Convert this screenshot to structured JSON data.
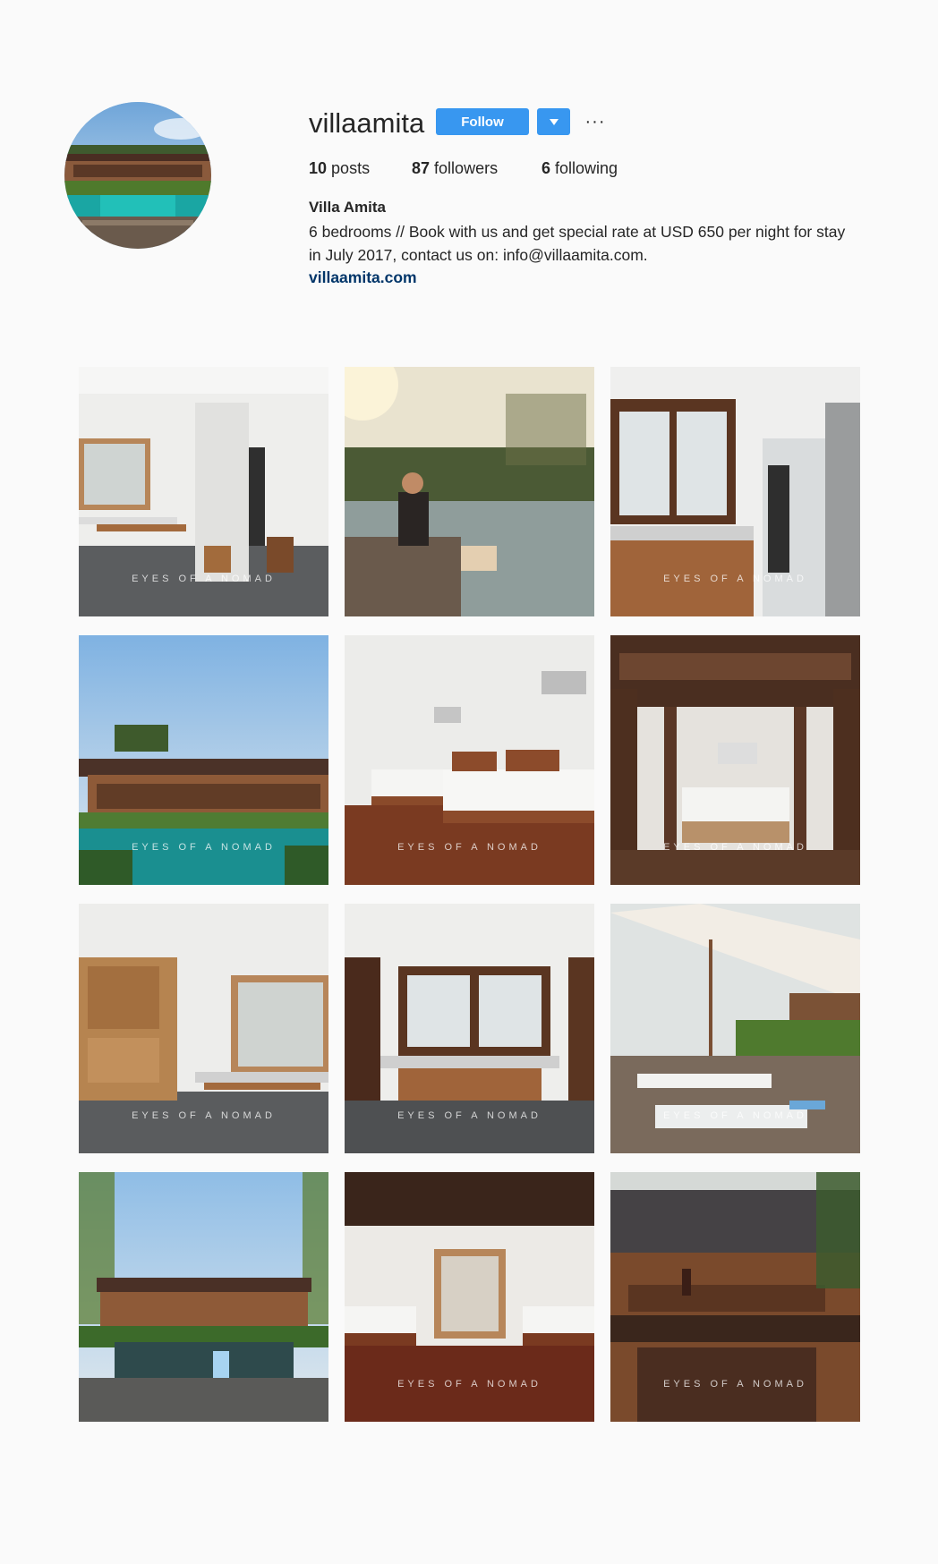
{
  "profile": {
    "username": "villaamita",
    "follow_label": "Follow",
    "more_label": "···",
    "stats": {
      "posts_count": "10",
      "posts_label": "posts",
      "followers_count": "87",
      "followers_label": "followers",
      "following_count": "6",
      "following_label": "following"
    },
    "full_name": "Villa Amita",
    "bio_line1": "6 bedrooms // Book with us and get special rate at USD 650 per night for stay",
    "bio_line2": "in July 2017, contact us on: info@villaamita.com.",
    "website": "villaamita.com"
  },
  "posts": [
    {
      "subject": "bathroom",
      "watermark": "EYES OF A NOMAD"
    },
    {
      "subject": "poolside-couple",
      "watermark": ""
    },
    {
      "subject": "bathroom-sink",
      "watermark": "EYES OF A NOMAD"
    },
    {
      "subject": "villa-pool-exterior",
      "watermark": "EYES OF A NOMAD"
    },
    {
      "subject": "twin-bedroom",
      "watermark": "EYES OF A NOMAD"
    },
    {
      "subject": "carved-canopy-bedroom",
      "watermark": "EYES OF A NOMAD"
    },
    {
      "subject": "wardrobe-bathroom",
      "watermark": "EYES OF A NOMAD"
    },
    {
      "subject": "washbasin-window",
      "watermark": "EYES OF A NOMAD"
    },
    {
      "subject": "sunloungers-umbrella",
      "watermark": "EYES OF A NOMAD"
    },
    {
      "subject": "pool-girl-villa",
      "watermark": ""
    },
    {
      "subject": "twin-beds-wooden-floor",
      "watermark": "EYES OF A NOMAD"
    },
    {
      "subject": "balcony-villa",
      "watermark": "EYES OF A NOMAD"
    }
  ],
  "colors": {
    "accent": "#3897f0",
    "link": "#003569",
    "background": "#fafafa",
    "text": "#262626"
  }
}
